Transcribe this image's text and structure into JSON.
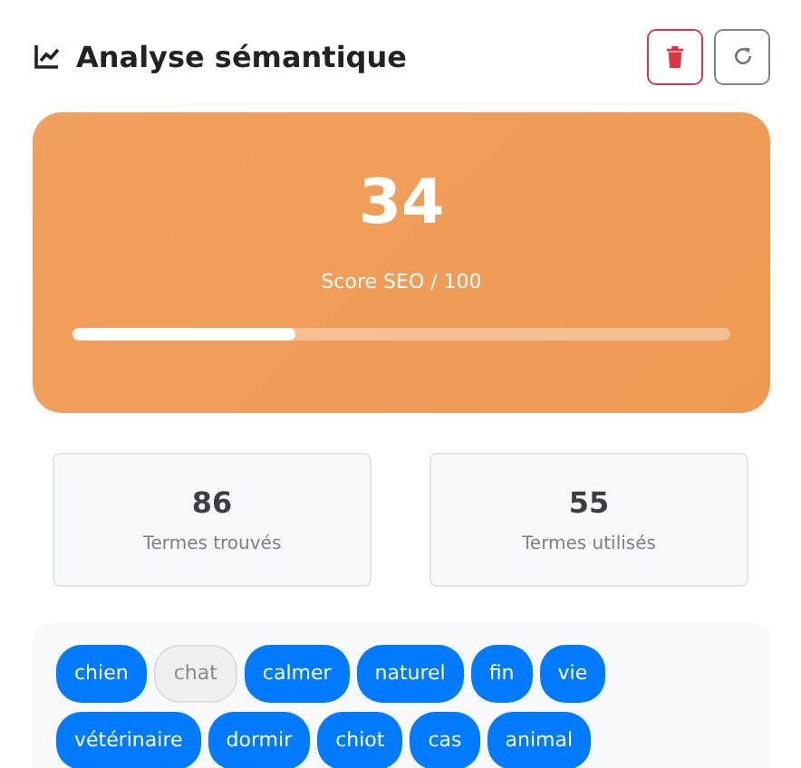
{
  "header": {
    "title": "Analyse sémantique"
  },
  "score": {
    "value": "34",
    "label": "Score SEO / 100",
    "level": 0.34
  },
  "stats": [
    {
      "value": "86",
      "label": "Termes trouvés"
    },
    {
      "value": "55",
      "label": "Termes utilisés"
    }
  ],
  "terms": [
    {
      "label": "chien",
      "used": true
    },
    {
      "label": "chat",
      "used": false
    },
    {
      "label": "calmer",
      "used": true
    },
    {
      "label": "naturel",
      "used": true
    },
    {
      "label": "fin",
      "used": true
    },
    {
      "label": "vie",
      "used": true
    },
    {
      "label": "vétérinaire",
      "used": true
    },
    {
      "label": "dormir",
      "used": true
    },
    {
      "label": "chiot",
      "used": true
    },
    {
      "label": "cas",
      "used": true
    },
    {
      "label": "animal",
      "used": true
    }
  ]
}
